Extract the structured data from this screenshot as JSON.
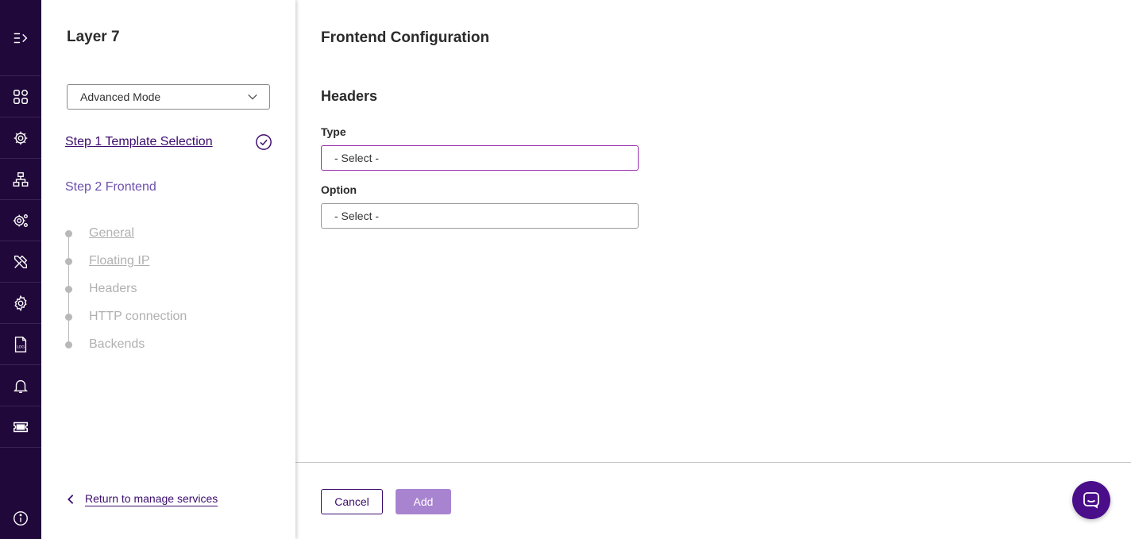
{
  "app": {
    "rail": {
      "icons": [
        "expand-menu-icon",
        "dashboard-icon",
        "services-icon",
        "network-icon",
        "configuration-icon",
        "tools-icon",
        "settings-icon",
        "logs-icon",
        "notifications-icon",
        "license-icon",
        "info-icon"
      ]
    },
    "steps_panel": {
      "title": "Layer 7",
      "mode_select": {
        "value": "Advanced Mode"
      },
      "step1": {
        "label": "Step 1 Template Selection",
        "completed": true
      },
      "step2": {
        "label": "Step 2 Frontend"
      },
      "substeps": [
        {
          "label": "General"
        },
        {
          "label": "Floating IP"
        },
        {
          "label": "Headers"
        },
        {
          "label": "HTTP connection"
        },
        {
          "label": "Backends"
        }
      ],
      "return_link": "Return to manage services"
    },
    "main": {
      "title": "Frontend Configuration",
      "section_title": "Headers",
      "type_field": {
        "label": "Type",
        "value": "- Select -"
      },
      "option_field": {
        "label": "Option",
        "value": "- Select -"
      },
      "cancel_label": "Cancel",
      "add_label": "Add"
    },
    "colors": {
      "rail_bg": "#21083a",
      "primary": "#3c0c6e",
      "accent_border": "#9b2fae",
      "add_button": "#a884d0",
      "chat_fab": "#4a0e8a"
    }
  }
}
